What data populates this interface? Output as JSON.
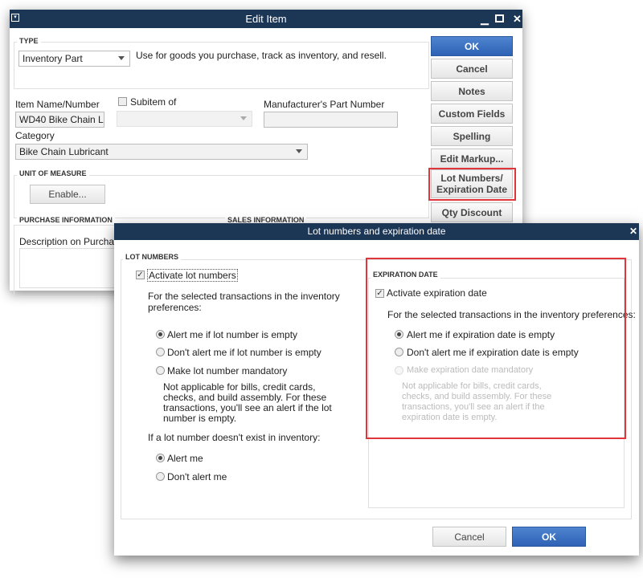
{
  "edit_item": {
    "title": "Edit Item",
    "type_section": "TYPE",
    "type_value": "Inventory Part",
    "type_description": "Use for goods you purchase, track as inventory, and resell.",
    "item_name_label": "Item Name/Number",
    "item_name_value": "WD40 Bike Chain L...",
    "subitem_label": "Subitem of",
    "manufacturer_label": "Manufacturer's Part Number",
    "category_label": "Category",
    "category_value": "Bike Chain Lubricant",
    "unit_section": "UNIT OF MEASURE",
    "enable_button": "Enable...",
    "purchase_section": "PURCHASE INFORMATION",
    "sales_section": "SALES INFORMATION",
    "purchase_desc_label": "Description on Purchase",
    "buttons": {
      "ok": "OK",
      "cancel": "Cancel",
      "notes": "Notes",
      "custom_fields": "Custom Fields",
      "spelling": "Spelling",
      "edit_markup": "Edit Markup...",
      "lot_numbers_1": "Lot Numbers/",
      "lot_numbers_2": "Expiration Date",
      "qty_discount": "Qty Discount"
    }
  },
  "dialog": {
    "title": "Lot numbers and expiration date",
    "lot": {
      "section": "LOT NUMBERS",
      "activate": "Activate lot numbers",
      "activate_checked": true,
      "prefs_1": "For the selected transactions in the inventory",
      "prefs_2": "preferences:",
      "options": [
        "Alert me if lot number is empty",
        "Don't alert me if lot number is empty",
        "Make lot number mandatory"
      ],
      "selected": 0,
      "note": [
        "Not applicable for bills, credit cards,",
        "checks, and build assembly. For these",
        "transactions, you'll see an alert if the lot",
        "number is empty."
      ],
      "missing_label": "If a lot number doesn't exist in inventory:",
      "missing_options": [
        "Alert me",
        "Don't alert me"
      ],
      "missing_selected": 0
    },
    "exp": {
      "section": "EXPIRATION DATE",
      "activate": "Activate expiration date",
      "activate_checked": true,
      "prefs": "For the selected transactions in the inventory preferences:",
      "options": [
        "Alert me if expiration date is empty",
        "Don't alert me if expiration date is empty",
        "Make expiration date mandatory"
      ],
      "selected": 0,
      "note": [
        "Not applicable for bills, credit cards,",
        "checks, and build assembly. For these",
        "transactions, you'll see an alert if the",
        "expiration date is empty."
      ]
    },
    "cancel": "Cancel",
    "ok": "OK"
  },
  "highlight_color": "#e0353a"
}
